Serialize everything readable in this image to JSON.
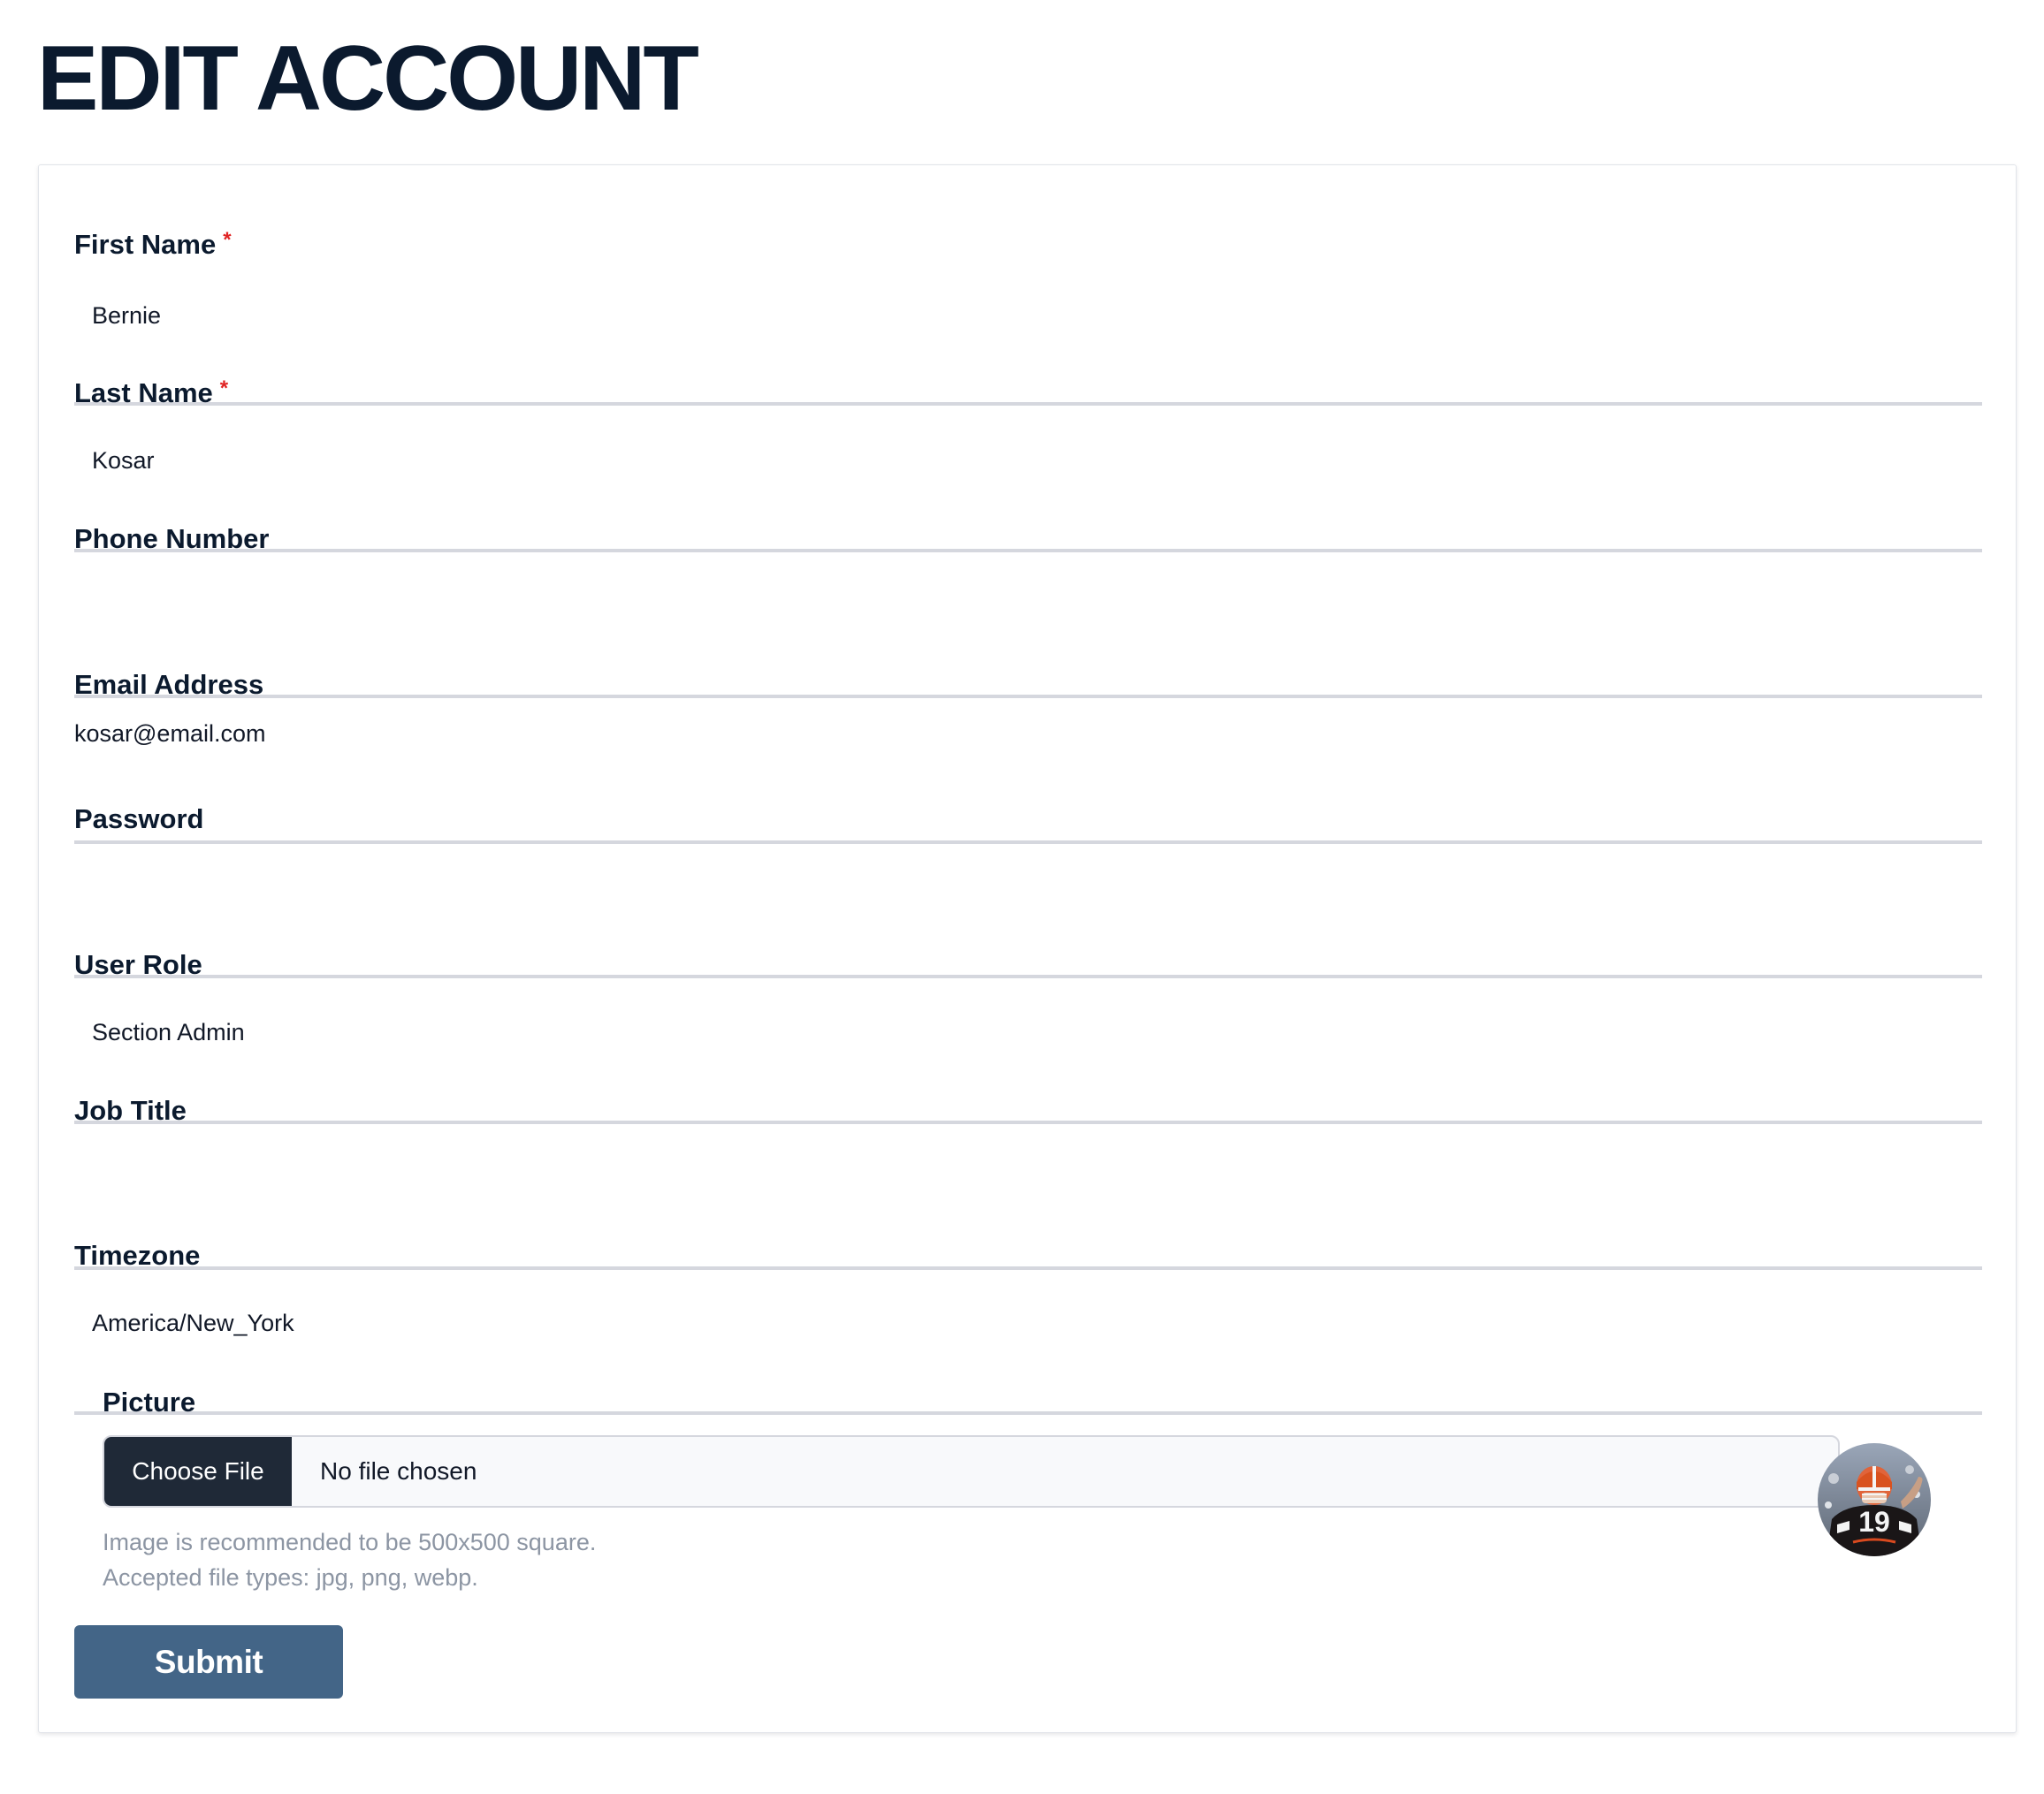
{
  "page": {
    "title": "EDIT ACCOUNT"
  },
  "form": {
    "first_name": {
      "label": "First Name",
      "required_mark": "*",
      "value": "Bernie"
    },
    "last_name": {
      "label": "Last Name",
      "required_mark": "*",
      "value": "Kosar"
    },
    "phone": {
      "label": "Phone Number",
      "value": ""
    },
    "email": {
      "label": "Email Address",
      "value": "kosar@email.com"
    },
    "password": {
      "label": "Password",
      "value": ""
    },
    "user_role": {
      "label": "User Role",
      "value": "Section Admin"
    },
    "job_title": {
      "label": "Job Title",
      "value": ""
    },
    "timezone": {
      "label": "Timezone",
      "value": "America/New_York"
    },
    "picture": {
      "label": "Picture",
      "choose_button": "Choose File",
      "status": "No file chosen",
      "hint_size": "Image is recommended to be 500x500 square.",
      "hint_types": "Accepted file types: jpg, png, webp.",
      "avatar_jersey_number": "19"
    },
    "submit_label": "Submit"
  },
  "colors": {
    "title": "#0b1a2e",
    "required": "#e02424",
    "submit_bg": "#436587",
    "choose_bg": "#1f2937",
    "hint": "#8c95a3",
    "underline": "#d5d7de"
  }
}
